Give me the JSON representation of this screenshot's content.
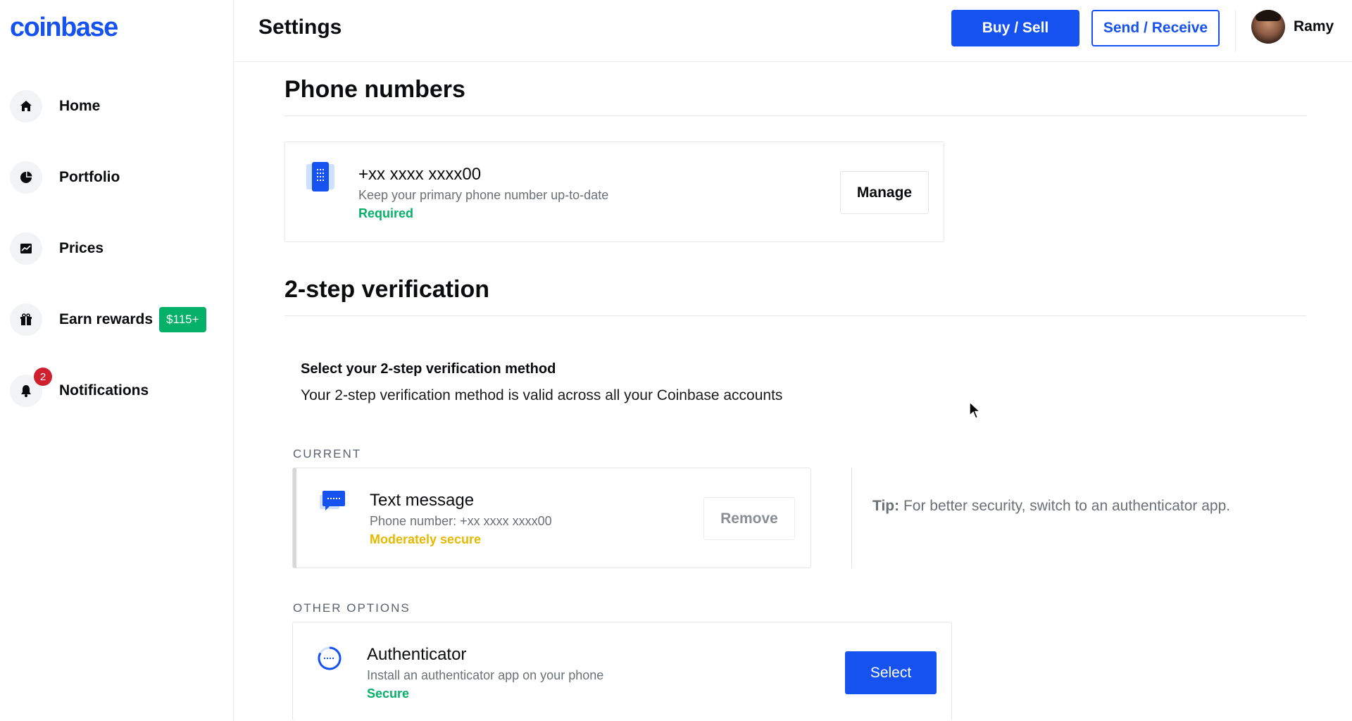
{
  "brand": {
    "logo": "coinbase",
    "accent": "#1652f0"
  },
  "sidebar": {
    "items": [
      {
        "label": "Home",
        "icon": "home-icon"
      },
      {
        "label": "Portfolio",
        "icon": "pie-chart-icon"
      },
      {
        "label": "Prices",
        "icon": "chart-icon"
      },
      {
        "label": "Earn rewards",
        "icon": "gift-icon",
        "badge": "$115+"
      },
      {
        "label": "Notifications",
        "icon": "bell-icon",
        "count": "2"
      }
    ]
  },
  "header": {
    "title": "Settings",
    "buy_sell": "Buy / Sell",
    "send_receive": "Send / Receive",
    "user_name": "Ramy"
  },
  "phone": {
    "section_title": "Phone numbers",
    "number": "+xx xxxx xxxx00",
    "description": "Keep your primary phone number up-to-date",
    "status": "Required",
    "manage": "Manage"
  },
  "two_step": {
    "section_title": "2-step verification",
    "heading": "Select your 2-step verification method",
    "body": "Your 2-step verification method is valid across all your Coinbase accounts",
    "current_label": "CURRENT",
    "current": {
      "title": "Text message",
      "sub": "Phone number: +xx xxxx xxxx00",
      "status": "Moderately secure",
      "remove": "Remove"
    },
    "tip_label": "Tip:",
    "tip_text": " For better security, switch to an authenticator app.",
    "other_label": "OTHER OPTIONS",
    "other": {
      "title": "Authenticator",
      "sub": "Install an authenticator app on your phone",
      "status": "Secure",
      "select": "Select"
    }
  },
  "colors": {
    "green": "#05b169",
    "yellow": "#e6b800",
    "red_badge": "#cf202f"
  }
}
